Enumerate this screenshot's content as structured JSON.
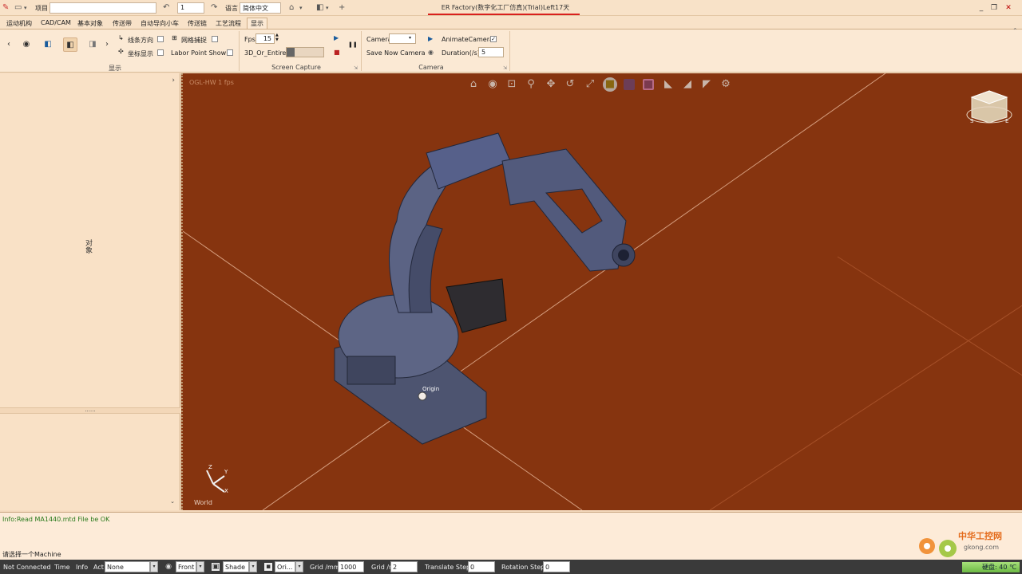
{
  "titlebar": {
    "project_label": "项目",
    "project_value": "",
    "step_value": "1",
    "language_label": "语言",
    "language_value": "简体中文",
    "title": "ER Factory(数字化工厂仿真)(Trial)Left17天"
  },
  "menu": {
    "items": [
      "运动机构",
      "CAD/CAM",
      "基本对象",
      "传送带",
      "自动导向小车",
      "传送链",
      "工艺流程",
      "显示"
    ],
    "active": "显示"
  },
  "ribbon": {
    "display_group": {
      "label": "显示",
      "line_direction": "线条方向",
      "grid_snap": "网格捕捉",
      "coord_display": "坐标显示",
      "labor_point": "Labor Point Show"
    },
    "screen_capture": {
      "label": "Screen Capture",
      "fps_label": "Fps",
      "fps_value": "15",
      "mode_label": "3D_Or_Entire"
    },
    "camera": {
      "label": "Camera",
      "camera_label": "Camera",
      "camera_value": "",
      "animate_label": "AnimateCamera",
      "animate_checked": "✓",
      "save_label": "Save Now Camera",
      "duration_label": "Duration(/s)",
      "duration_value": "5"
    }
  },
  "left_panel": {
    "vertical_label": "对象",
    "splitter": "......"
  },
  "viewport": {
    "info": "OGL-HW 1 fps",
    "origin_label": "Origin",
    "world_label": "World",
    "axis_x": "X",
    "axis_y": "Y",
    "axis_z": "Z",
    "cube_s": "S",
    "cube_e": "E",
    "background_color": "#86340f"
  },
  "output": {
    "info_line": "Info:Read MA1440.mtd File be OK",
    "prompt": "请选择一个Machine"
  },
  "statusbar": {
    "connection": "Not Connected",
    "time_label": "Time",
    "info_label": "Info",
    "act_label": "Act",
    "act_value": "None",
    "view_value": "Front",
    "shade_value": "Shade",
    "ori_value": "Ori...",
    "grid_mm_label": "Grid /mm",
    "grid_mm_value": "1000",
    "grid_n_label": "Grid /n",
    "grid_n_value": "2",
    "translate_label": "Translate Step",
    "translate_value": "0",
    "rotation_label": "Rotation Step",
    "rotation_value": "0",
    "disk": "硬盘: 40 ℃"
  },
  "watermark": {
    "line1": "中华工控网",
    "line2": "gkong.com"
  }
}
